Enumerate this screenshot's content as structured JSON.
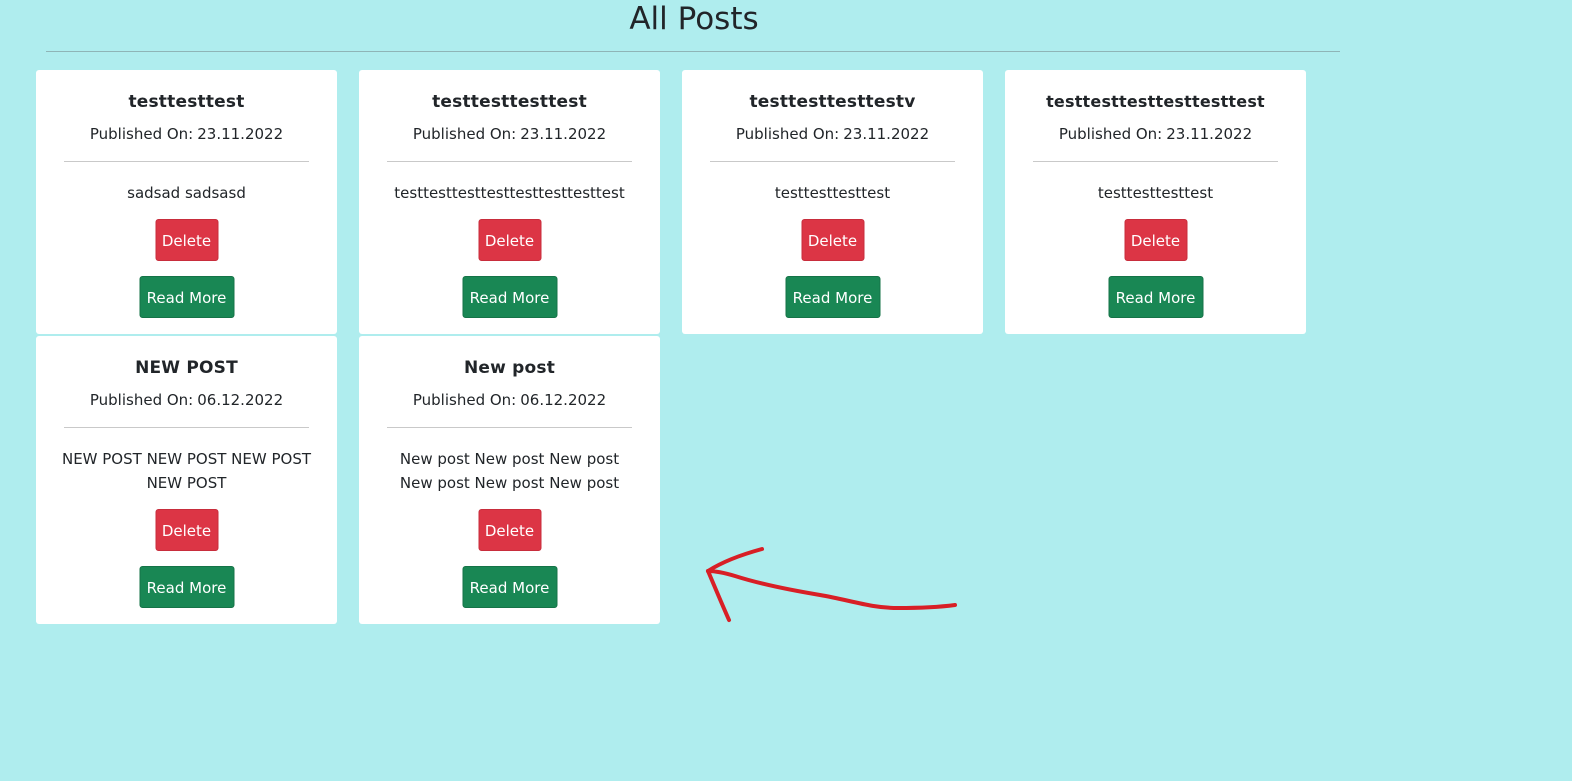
{
  "page": {
    "title": "All Posts",
    "background": "#afedee"
  },
  "labels": {
    "published_on": "Published On:",
    "delete": "Delete",
    "read_more": "Read More"
  },
  "colors": {
    "delete_button": "#dc3545",
    "read_more_button": "#198754",
    "annotation": "#d81f26"
  },
  "posts": [
    {
      "title": "testtesttest",
      "date": "23.11.2022",
      "body": "sadsad sadsasd"
    },
    {
      "title": "testtesttesttest",
      "date": "23.11.2022",
      "body": "testtesttesttesttesttesttesttest"
    },
    {
      "title": "testtesttesttestv",
      "date": "23.11.2022",
      "body": "testtesttesttest"
    },
    {
      "title": "testtesttesttesttesttest",
      "date": "23.11.2022",
      "body": "testtesttesttest"
    },
    {
      "title": "NEW POST",
      "date": "06.12.2022",
      "body": "NEW POST NEW POST NEW POST NEW POST"
    },
    {
      "title": "New post",
      "date": "06.12.2022",
      "body": "New post New post New post New post New post New post"
    }
  ]
}
